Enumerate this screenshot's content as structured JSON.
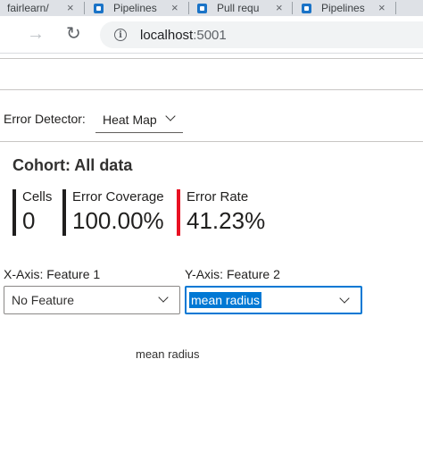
{
  "browser": {
    "tabs": [
      {
        "title": "fairlearn/"
      },
      {
        "title": "Pipelines"
      },
      {
        "title": "Pull requ"
      },
      {
        "title": "Pipelines"
      }
    ],
    "url_host": "localhost",
    "url_port": ":5001"
  },
  "error_detector": {
    "label": "Error Detector:",
    "selected": "Heat Map"
  },
  "cohort": {
    "title": "Cohort: All data"
  },
  "metrics": [
    {
      "label": "Cells",
      "value": "0",
      "bar_color": "#201f1e"
    },
    {
      "label": "Error Coverage",
      "value": "100.00%",
      "bar_color": "#201f1e"
    },
    {
      "label": "Error Rate",
      "value": "41.23%",
      "bar_color": "#e81123"
    }
  ],
  "x_axis": {
    "label": "X-Axis: Feature 1",
    "selected": "No Feature"
  },
  "y_axis": {
    "label": "Y-Axis: Feature 2",
    "selected": "mean radius"
  },
  "plot": {
    "axis_title": "mean radius"
  }
}
